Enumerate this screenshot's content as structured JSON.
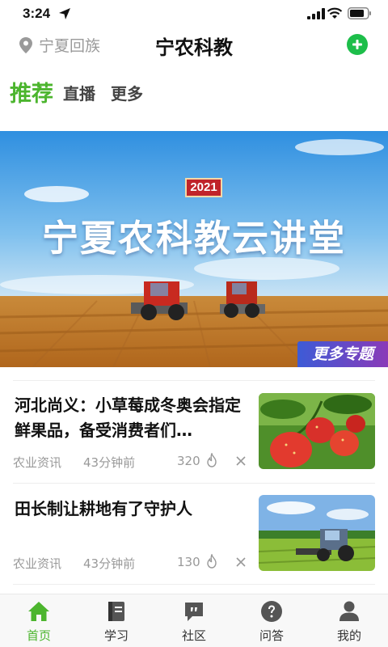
{
  "status_bar": {
    "time": "3:24"
  },
  "header": {
    "location": "宁夏回族",
    "title": "宁农科教",
    "add_color": "#1dbe4a"
  },
  "tabs": [
    {
      "label": "推荐",
      "active": true
    },
    {
      "label": "直播",
      "active": false
    },
    {
      "label": "更多",
      "active": false
    }
  ],
  "banner": {
    "year": "2021",
    "title": "宁夏农科教云讲堂",
    "more_topics": "更多专题"
  },
  "news": [
    {
      "title": "河北尚义：小草莓成冬奥会指定鲜果品，备受消费者们…",
      "category": "农业资讯",
      "time": "43分钟前",
      "views": "320",
      "thumb_icon": "strawberry-image"
    },
    {
      "title": "田长制让耕地有了守护人",
      "category": "农业资讯",
      "time": "43分钟前",
      "views": "130",
      "thumb_icon": "tractor-field-image"
    }
  ],
  "bottom_nav": [
    {
      "label": "首页",
      "icon": "home-icon",
      "active": true
    },
    {
      "label": "学习",
      "icon": "book-icon",
      "active": false
    },
    {
      "label": "社区",
      "icon": "chat-bubble-icon",
      "active": false
    },
    {
      "label": "问答",
      "icon": "question-icon",
      "active": false
    },
    {
      "label": "我的",
      "icon": "user-icon",
      "active": false
    }
  ],
  "colors": {
    "accent": "#4cb52e",
    "muted": "#999999"
  }
}
